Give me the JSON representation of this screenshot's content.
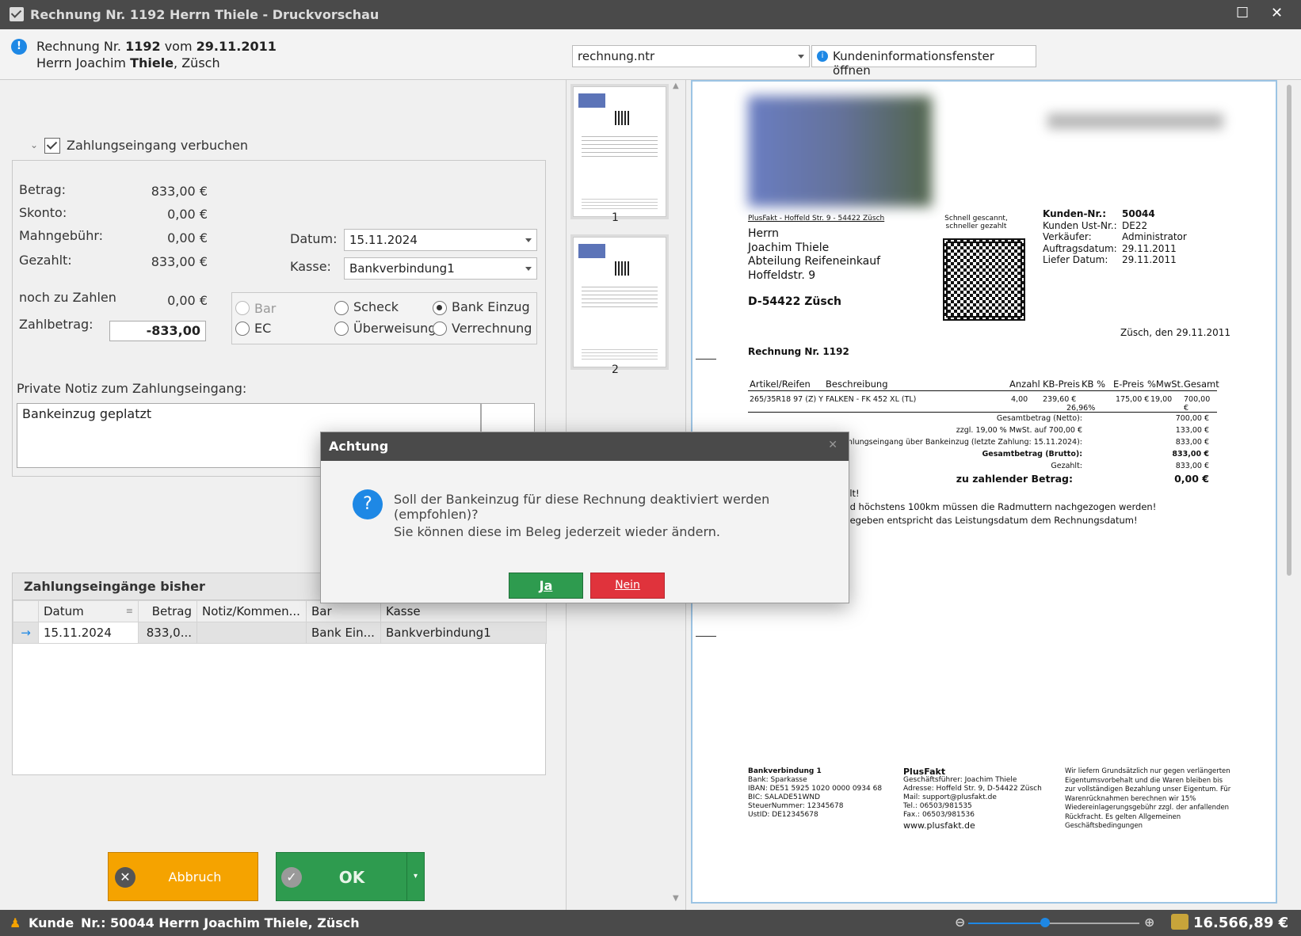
{
  "window": {
    "title": "Rechnung Nr. 1192 Herrn Thiele - Druckvorschau",
    "maximize_glyph": "☐",
    "close_glyph": "✕"
  },
  "header": {
    "line1_prefix": "Rechnung Nr. ",
    "line1_number": "1192",
    "line1_mid": " vom ",
    "line1_date": "29.11.2011",
    "line2_prefix": "Herrn Joachim ",
    "line2_name": "Thiele",
    "line2_suffix": ", Züsch",
    "template": "rechnung.ntr",
    "customer_info_button": "Kundeninformationsfenster öffnen"
  },
  "payment": {
    "toggle_label": "Zahlungseingang verbuchen",
    "betrag_label": "Betrag:",
    "betrag": "833,00 €",
    "skonto_label": "Skonto:",
    "skonto": "0,00 €",
    "mahn_label": "Mahngebühr:",
    "mahn": "0,00 €",
    "gezahlt_label": "Gezahlt:",
    "gezahlt": "833,00 €",
    "noch_label": "noch zu Zahlen",
    "noch": "0,00 €",
    "zahlbetrag_label": "Zahlbetrag:",
    "zahlbetrag": "-833,00",
    "datum_label": "Datum:",
    "datum": "15.11.2024",
    "kasse_label": "Kasse:",
    "kasse": "Bankverbindung1",
    "methods": {
      "bar": "Bar",
      "scheck": "Scheck",
      "bank": "Bank Einzug",
      "ec": "EC",
      "ueberweisung": "Überweisung",
      "verrechnung": "Verrechnung"
    },
    "note_label": "Private Notiz zum Zahlungseingang:",
    "note": "Bankeinzug geplatzt"
  },
  "history": {
    "title": "Zahlungseingänge bisher",
    "columns": [
      "Datum",
      "Betrag",
      "Notiz/Kommen...",
      "Bar",
      "Kasse"
    ],
    "rows": [
      {
        "datum": "15.11.2024",
        "betrag": "833,0...",
        "notiz": "",
        "bar": "Bank Ein...",
        "kasse": "Bankverbindung1"
      }
    ]
  },
  "buttons": {
    "abbruch": "Abbruch",
    "ok": "OK"
  },
  "thumbs": {
    "page1": "1",
    "page2": "2"
  },
  "document": {
    "sender_line": "PlusFakt - Hoffeld Str. 9 - 54422 Züsch",
    "addr1": "Herrn",
    "addr2": "Joachim Thiele",
    "addr3": "Abteilung Reifeneinkauf",
    "addr4": "Hoffeldstr. 9",
    "city": "D-54422 Züsch",
    "qr_note1": "Schnell gescannt,",
    "qr_note2": "schneller gezahlt",
    "kunden_nr_label": "Kunden-Nr.:",
    "kunden_nr": "50044",
    "ust_label": "Kunden Ust-Nr.:",
    "ust": "DE22",
    "verk_label": "Verkäufer:",
    "verk": "Administrator",
    "auftrag_label": "Auftragsdatum:",
    "auftrag": "29.11.2011",
    "liefer_label": "Liefer Datum:",
    "liefer": "29.11.2011",
    "place_date": "Züsch, den 29.11.2011",
    "invoice_title": "Rechnung Nr. 1192",
    "cols": {
      "artikel": "Artikel/Reifen",
      "beschreibung": "Beschreibung",
      "anzahl": "Anzahl",
      "kbpreis": "KB-Preis",
      "kbp": "KB %",
      "epreis": "E-Preis",
      "mwst": "%MwSt.",
      "gesamt": "Gesamt"
    },
    "item": {
      "artikel": "265/35R18 97 (Z) Y",
      "beschreibung": "FALKEN - FK 452 XL (TL)",
      "anzahl": "4,00",
      "kbpreis": "239,60 €",
      "kbp": "26,96%",
      "epreis": "175,00 €",
      "mwst": "19,00",
      "gesamt": "700,00 €"
    },
    "sum_netto_label": "Gesamtbetrag (Netto):",
    "sum_netto": "700,00 €",
    "mwst_label": "zzgl. 19,00 % MwSt. auf 700,00 €",
    "mwst_val": "133,00 €",
    "zahl_label": "Zahlungseingang über Bankeinzug (letzte Zahlung: 15.11.2024):",
    "zahl_val": "833,00 €",
    "brutto_label": "Gesamtbetrag (Brutto):",
    "brutto": "833,00 €",
    "gez_label": "Gezahlt:",
    "gez": "833,00 €",
    "zu_label": "zu zahlender Betrag:",
    "zu": "0,00 €",
    "text1": "halt!",
    "text2": "und höchstens 100km müssen die Radmuttern nachgezogen werden!",
    "text3": "ngegeben entspricht das Leistungsdatum dem Rechnungsdatum!",
    "footer_bank": [
      "Bankverbindung 1",
      "Bank: Sparkasse",
      "IBAN: DE51 5925 1020 0000 0934 68",
      "BIC: SALADE51WND",
      "SteuerNummer: 12345678",
      "UstID: DE12345678"
    ],
    "footer_company": [
      "PlusFakt",
      "Geschäftsführer: Joachim Thiele",
      "Adresse: Hoffeld Str. 9, D-54422 Züsch",
      "Mail: support@plusfakt.de",
      "Tel.: 06503/981535",
      "Fax.: 06503/981536",
      "www.plusfakt.de"
    ],
    "footer_terms": [
      "Wir liefern Grundsätzlich nur gegen verlängerten",
      "Eigentumsvorbehalt und die Waren bleiben bis",
      "zur vollständigen Bezahlung unser Eigentum. Für",
      "Warenrücknahmen berechnen wir 15%",
      "Wiedereinlagerungsgebühr zzgl. der anfallenden",
      "Rückfracht. Es gelten Allgemeinen",
      "Geschäftsbedingungen"
    ]
  },
  "dialog": {
    "title": "Achtung",
    "close_glyph": "✕",
    "question": "Soll der Bankeinzug für diese Rechnung deaktiviert werden (empfohlen)?",
    "info": "Sie können diese im Beleg jederzeit wieder ändern.",
    "yes": "Ja",
    "no": "Nein"
  },
  "status": {
    "label": "Kunde",
    "text": "Nr.: 50044 Herrn Joachim Thiele, Züsch",
    "balance": "16.566,89 €",
    "zoom_level": 0.45
  },
  "colors": {
    "accent": "#1e88e5",
    "ok_green": "#2e9b4f",
    "cancel_orange": "#f5a300",
    "nein_red": "#e0333c"
  }
}
